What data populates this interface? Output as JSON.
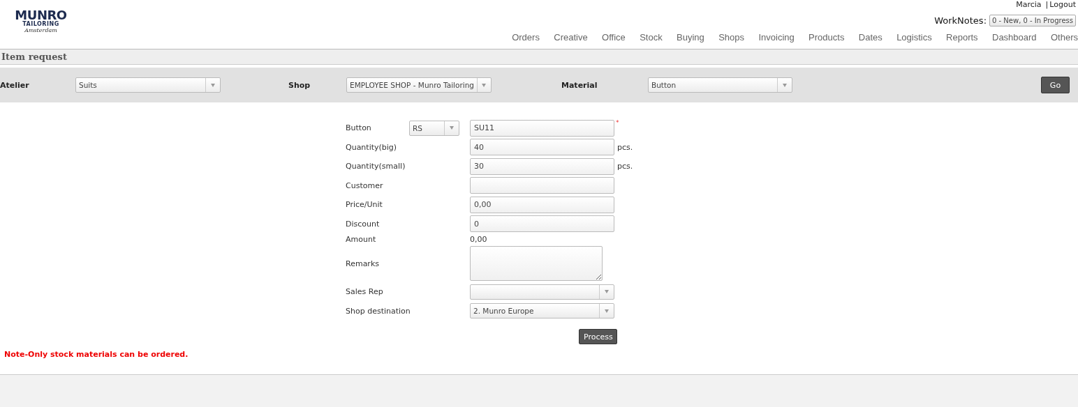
{
  "logo": {
    "name": "MUNRO",
    "sub": "TAILORING",
    "city": "Amsterdam"
  },
  "user": {
    "name": "Marcia",
    "separator": "|",
    "logout": "Logout"
  },
  "worknotes": {
    "label": "WorkNotes:",
    "button": "0 - New, 0 - In Progress"
  },
  "nav": [
    {
      "label": "Orders"
    },
    {
      "label": "Creative"
    },
    {
      "label": "Office"
    },
    {
      "label": "Stock"
    },
    {
      "label": "Buying"
    },
    {
      "label": "Shops"
    },
    {
      "label": "Invoicing"
    },
    {
      "label": "Products"
    },
    {
      "label": "Dates"
    },
    {
      "label": "Logistics"
    },
    {
      "label": "Reports"
    },
    {
      "label": "Dashboard"
    },
    {
      "label": "Others"
    }
  ],
  "page_title": "Item request",
  "filters": [
    {
      "label": "Atelier",
      "value": "Suits"
    },
    {
      "label": "Shop",
      "value": "EMPLOYEE SHOP - Munro Tailoring"
    },
    {
      "label": "Material",
      "value": "Button"
    }
  ],
  "go_button": "Go",
  "form": [
    {
      "kind": "select_input",
      "label": "Button",
      "option": "RS",
      "value": "SU11",
      "required": "*"
    },
    {
      "kind": "input",
      "label": "Quantity(big)",
      "value": "40",
      "unit": "pcs."
    },
    {
      "kind": "input",
      "label": "Quantity(small)",
      "value": "30",
      "unit": "pcs."
    },
    {
      "kind": "input",
      "label": "Customer"
    },
    {
      "kind": "input",
      "label": "Price/Unit",
      "value": "0,00"
    },
    {
      "kind": "input",
      "label": "Discount",
      "value": "0"
    },
    {
      "kind": "text",
      "label": "Amount",
      "value": "0,00"
    },
    {
      "kind": "textarea",
      "label": "Remarks"
    },
    {
      "kind": "select",
      "label": "Sales Rep"
    },
    {
      "kind": "select",
      "label": "Shop destination",
      "value": "2. Munro Europe"
    }
  ],
  "process_button": "Process",
  "note": "Note-Only stock materials can be ordered."
}
